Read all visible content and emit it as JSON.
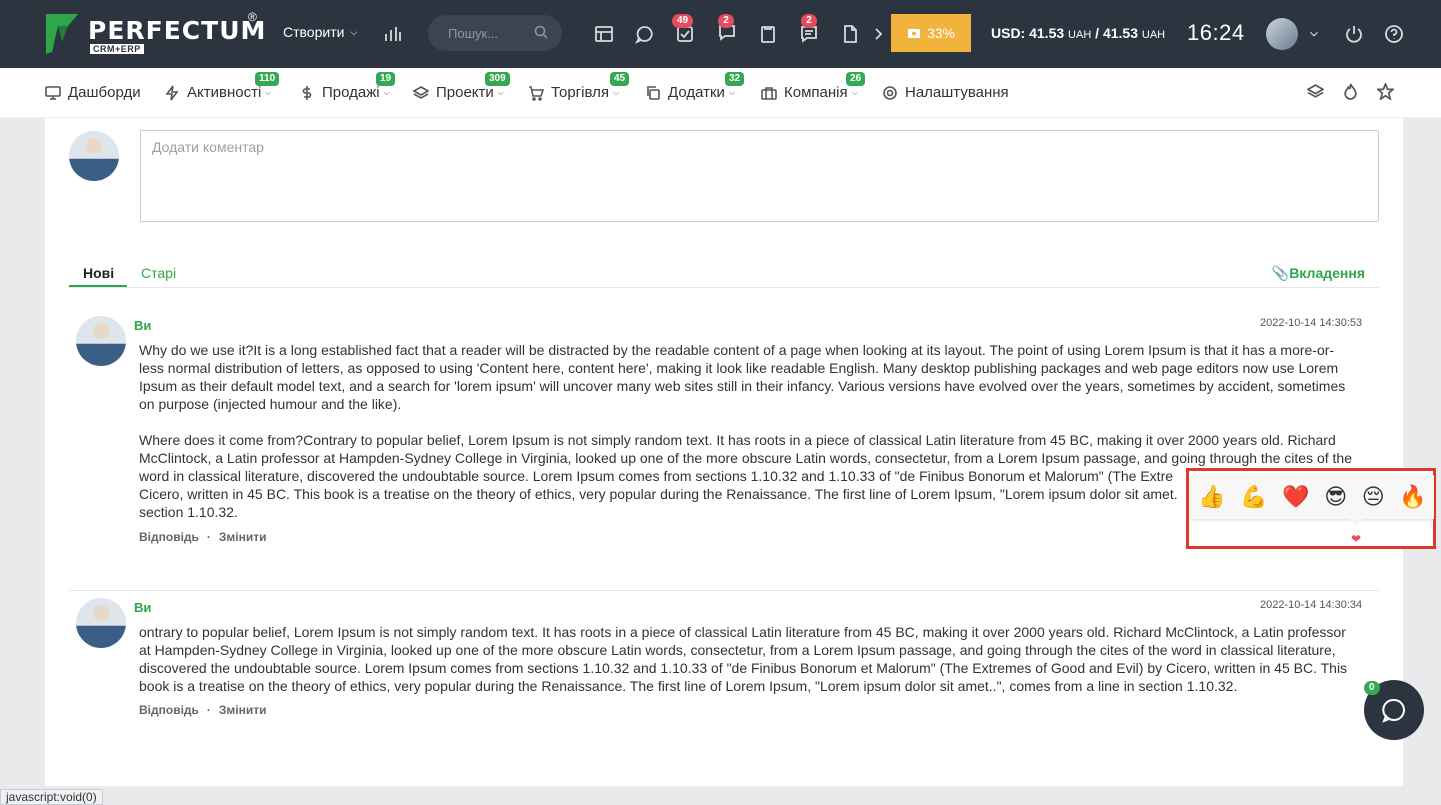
{
  "topbar": {
    "logo_text": "PERFECTUM",
    "logo_reg": "®",
    "logo_sub": "CRM+ERP",
    "create_label": "Створити",
    "search_placeholder": "Пошук...",
    "badges": {
      "tasks": "49",
      "notifications": "2",
      "messages": "2"
    },
    "progress_label": "33%",
    "progress_value": 33,
    "currency_usd": "USD: 41.53",
    "currency_unit1": "UAH",
    "currency_sep": " / 41.53 ",
    "currency_unit2": "UAH",
    "clock": "16:24",
    "accent_color": "#f2b33d",
    "background_color": "#2c3440"
  },
  "nav": {
    "items": [
      {
        "label": "Дашборди",
        "badge": ""
      },
      {
        "label": "Активності",
        "badge": "110"
      },
      {
        "label": "Продажі",
        "badge": "19"
      },
      {
        "label": "Проекти",
        "badge": "309"
      },
      {
        "label": "Торгівля",
        "badge": "45"
      },
      {
        "label": "Додатки",
        "badge": "32"
      },
      {
        "label": "Компанія",
        "badge": "26"
      },
      {
        "label": "Налаштування",
        "badge": ""
      }
    ],
    "badge_color": "#34a853"
  },
  "comment": {
    "placeholder": "Додати коментар"
  },
  "tabs": {
    "new": "Нові",
    "old": "Старі",
    "attachments": "Вкладення"
  },
  "messages": [
    {
      "author": "Ви",
      "date": "2022-10-14 14:30:53",
      "lines": [
        "Why do we use it?It is a long established fact that a reader will be distracted by the readable content of a page when looking at its layout. The point of using Lorem Ipsum is that it has a more-or-",
        "less normal distribution of letters, as opposed to using 'Content here, content here', making it look like readable English. Many desktop publishing packages and web page editors now use Lorem",
        "Ipsum as their default model text, and a search for 'lorem ipsum' will uncover many web sites still in their infancy. Various versions have evolved over the years, sometimes by accident, sometimes",
        "on purpose (injected humour and the like).",
        "",
        "Where does it come from?Contrary to popular belief, Lorem Ipsum is not simply random text. It has roots in a piece of classical Latin literature from 45 BC, making it over 2000 years old. Richard",
        "McClintock, a Latin professor at Hampden-Sydney College in Virginia, looked up one of the more obscure Latin words, consectetur, from a Lorem Ipsum passage, and going through the cites of the",
        "word in classical literature, discovered the undoubtable source. Lorem Ipsum comes from sections 1.10.32 and 1.10.33 of \"de Finibus Bonorum et Malorum\" (The Extre",
        "Cicero, written in 45 BC. This book is a treatise on the theory of ethics, very popular during the Renaissance. The first line of Lorem Ipsum, \"Lorem ipsum dolor sit amet.",
        "section 1.10.32."
      ],
      "reply": "Відповідь",
      "edit": "Змінити"
    },
    {
      "author": "Ви",
      "date": "2022-10-14 14:30:34",
      "lines": [
        "ontrary to popular belief, Lorem Ipsum is not simply random text. It has roots in a piece of classical Latin literature from 45 BC, making it over 2000 years old. Richard McClintock, a Latin professor",
        "at Hampden-Sydney College in Virginia, looked up one of the more obscure Latin words, consectetur, from a Lorem Ipsum passage, and going through the cites of the word in classical literature,",
        "discovered the undoubtable source. Lorem Ipsum comes from sections 1.10.32 and 1.10.33 of \"de Finibus Bonorum et Malorum\" (The Extremes of Good and Evil) by Cicero, written in 45 BC. This",
        "book is a treatise on the theory of ethics, very popular during the Renaissance. The first line of Lorem Ipsum, \"Lorem ipsum dolor sit amet..\", comes from a line in section 1.10.32."
      ],
      "reply": "Відповідь",
      "edit": "Змінити"
    }
  ],
  "reactions": {
    "emojis": [
      "👍",
      "💪",
      "❤️",
      "😎",
      "😔",
      "🔥"
    ],
    "selected": "❤",
    "highlight_color": "#e0392b"
  },
  "chat": {
    "badge": "0"
  },
  "status_url": "javascript:void(0)"
}
